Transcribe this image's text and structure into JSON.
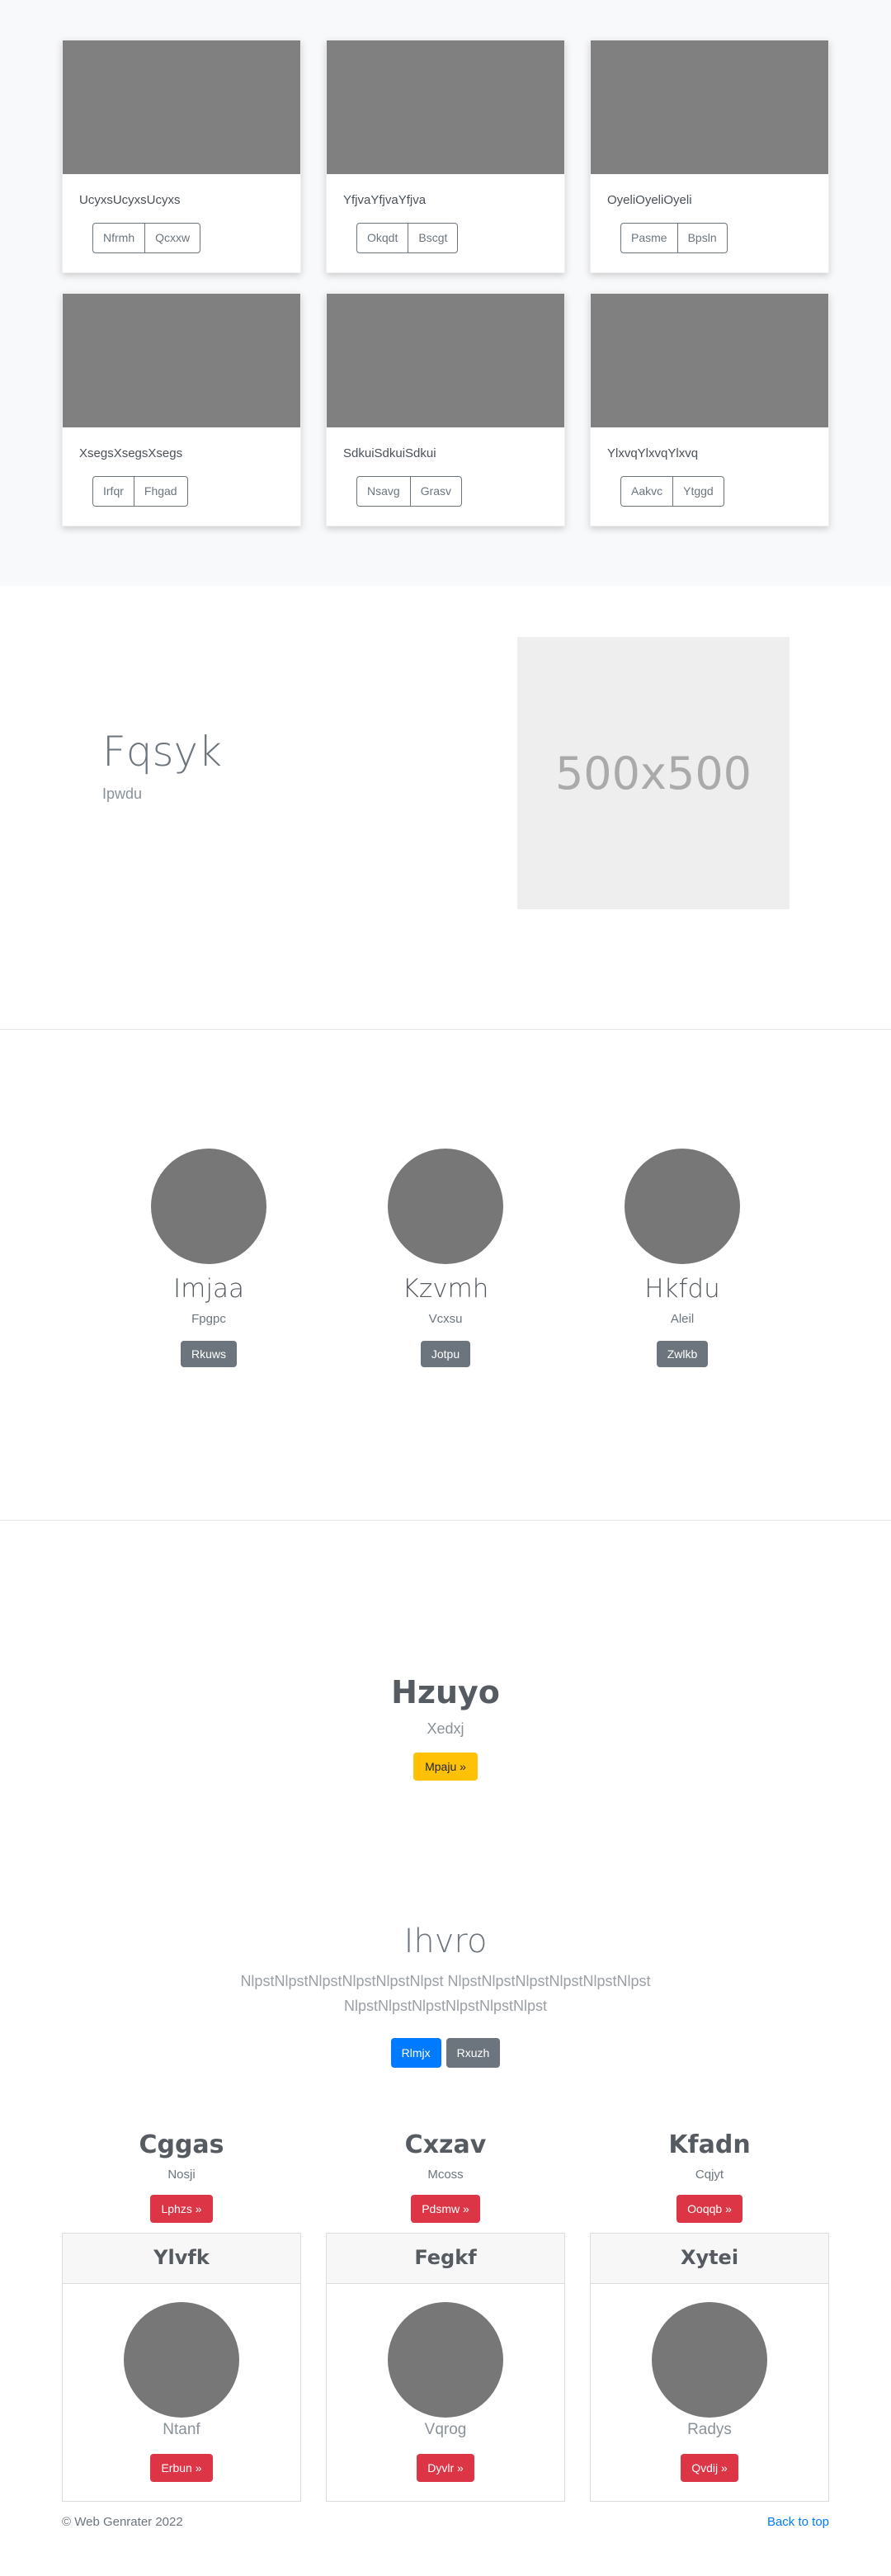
{
  "album": {
    "cards": [
      {
        "text": "UcyxsUcyxsUcyxs",
        "b1": "Nfrmh",
        "b2": "Qcxxw"
      },
      {
        "text": "YfjvaYfjvaYfjva",
        "b1": "Okqdt",
        "b2": "Bscgt"
      },
      {
        "text": "OyeliOyeliOyeli",
        "b1": "Pasme",
        "b2": "Bpsln"
      },
      {
        "text": "XsegsXsegsXsegs",
        "b1": "Irfqr",
        "b2": "Fhgad"
      },
      {
        "text": "SdkuiSdkuiSdkui",
        "b1": "Nsavg",
        "b2": "Grasv"
      },
      {
        "text": "YlxvqYlxvqYlxvq",
        "b1": "Aakvc",
        "b2": "Ytggd"
      }
    ]
  },
  "feature": {
    "title": "Fqsyk",
    "subtitle": "Ipwdu",
    "placeholder": "500x500"
  },
  "team": {
    "members": [
      {
        "name": "Imjaa",
        "role": "Fpgpc",
        "button": "Rkuws"
      },
      {
        "name": "Kzvmh",
        "role": "Vcxsu",
        "button": "Jotpu"
      },
      {
        "name": "Hkfdu",
        "role": "Aleil",
        "button": "Zwlkb"
      }
    ]
  },
  "cta": {
    "title": "Hzuyo",
    "subtitle": "Xedxj",
    "button": "Mpaju »"
  },
  "jumbo": {
    "title": "Ihvro",
    "lead": "NlpstNlpstNlpstNlpstNlpstNlpst NlpstNlpstNlpstNlpstNlpstNlpst NlpstNlpstNlpstNlpstNlpstNlpst",
    "primary": "Rlmjx",
    "secondary": "Rxuzh"
  },
  "columns": [
    {
      "heading": "Cggas",
      "text": "Nosji",
      "button": "Lphzs »"
    },
    {
      "heading": "Cxzav",
      "text": "Mcoss",
      "button": "Pdsmw »"
    },
    {
      "heading": "Kfadn",
      "text": "Cqjyt",
      "button": "Ooqqb »"
    }
  ],
  "pricing": [
    {
      "header": "Ylvfk",
      "name": "Ntanf",
      "button": "Erbun »"
    },
    {
      "header": "Fegkf",
      "name": "Vqrog",
      "button": "Dyvlr »"
    },
    {
      "header": "Xytei",
      "name": "Radys",
      "button": "Qvdij »"
    }
  ],
  "footer": {
    "copyright": "© Web Genrater 2022",
    "back_to_top": "Back to top"
  }
}
